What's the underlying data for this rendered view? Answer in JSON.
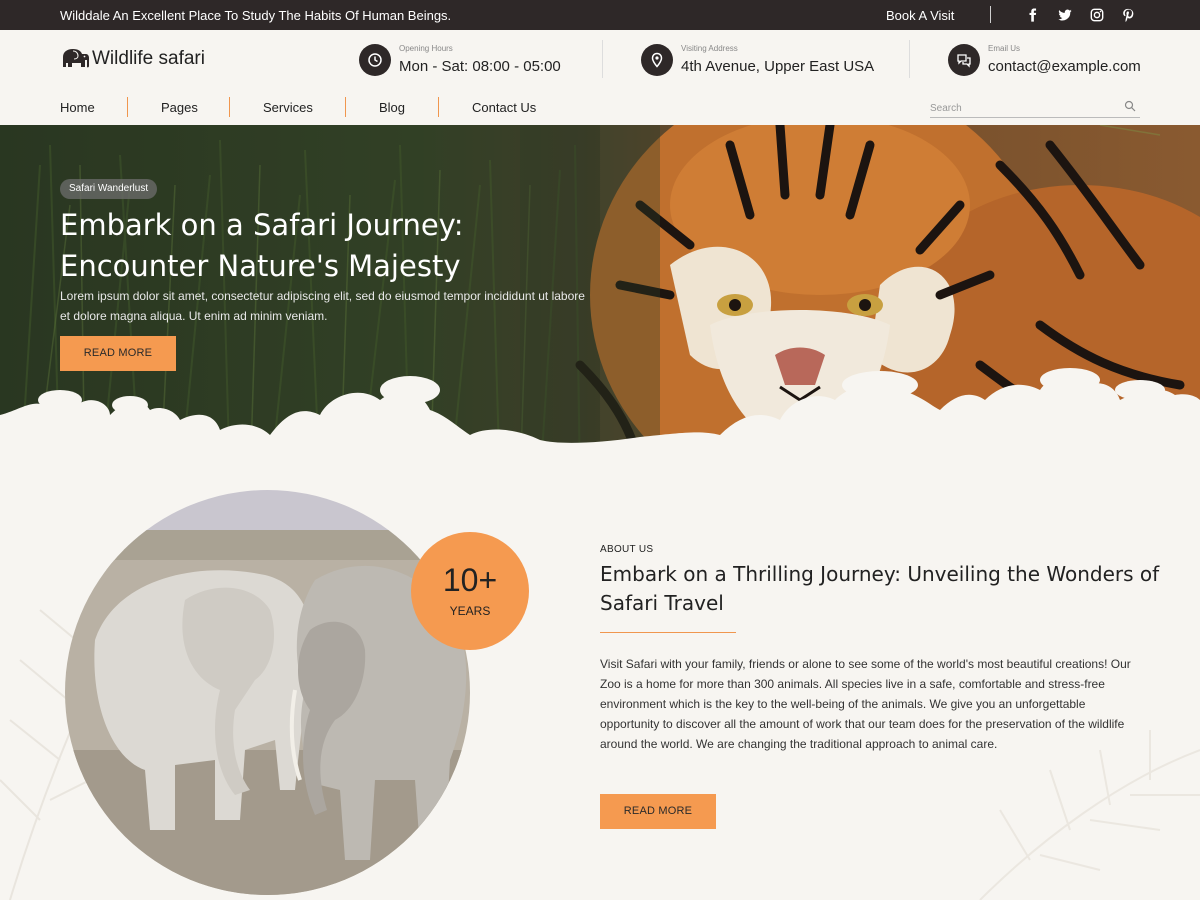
{
  "topbar": {
    "tagline": "Wilddale An Excellent Place To Study The Habits Of Human Beings.",
    "book_label": "Book A Visit",
    "social": [
      "facebook-icon",
      "twitter-icon",
      "instagram-icon",
      "pinterest-icon"
    ]
  },
  "header": {
    "logo_text": "Wildlife safari",
    "hours": {
      "label": "Opening Hours",
      "value": "Mon - Sat: 08:00 - 05:00"
    },
    "address": {
      "label": "Visiting Address",
      "value": "4th Avenue, Upper East USA"
    },
    "email": {
      "label": "Email Us",
      "value": "contact@example.com"
    }
  },
  "nav": {
    "items": [
      "Home",
      "Pages",
      "Services",
      "Blog",
      "Contact Us"
    ],
    "search_placeholder": "Search"
  },
  "hero": {
    "badge": "Safari Wanderlust",
    "title": "Embark on a Safari Journey: Encounter Nature's Majesty",
    "text": "Lorem ipsum dolor sit amet, consectetur adipiscing elit, sed do eiusmod tempor incididunt ut labore et dolore magna aliqua. Ut enim ad minim veniam.",
    "button": "READ MORE"
  },
  "about": {
    "years_number": "10+",
    "years_label": "YEARS",
    "kicker": "ABOUT US",
    "title": "Embark on a Thrilling Journey: Unveiling the Wonders of Safari Travel",
    "text": "Visit Safari with your family, friends or alone to see some of the world's most beautiful creations! Our Zoo is a home for more than 300 animals. All species live in a safe, comfortable and stress-free environment which is the key to the well-being of the animals. We give you an unforgettable opportunity to discover all the amount of work that our team does for the preservation of the wildlife around the world. We are changing the traditional approach to animal care.",
    "button": "READ MORE"
  },
  "colors": {
    "accent": "#f59a50",
    "dark": "#2e2828",
    "background": "#f7f5f1"
  }
}
